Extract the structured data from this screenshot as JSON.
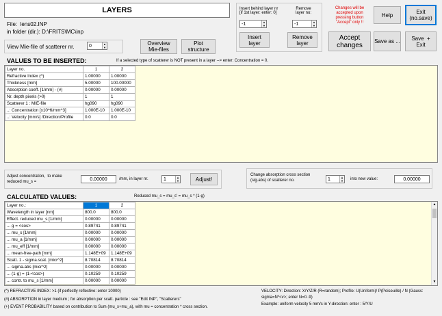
{
  "title": "LAYERS",
  "file_label": "File:",
  "file_name": "lens02.INP",
  "folder_label": "in folder (dir.):",
  "folder_path": "D:\\FRITS\\MC\\inp",
  "view_mie_label": "View Mie-file of scatterer nr.",
  "view_mie_value": "0",
  "overview_btn": "Overview\nMie-files",
  "plot_btn": "Plot\nstructure",
  "insert_behind_label": "Insert behind layer nr\n[if 1st layer: enter: 0]",
  "insert_value": "-1",
  "remove_label": "Remove\nlayer no:",
  "remove_value": "-1",
  "insert_btn": "Insert\nlayer",
  "remove_btn": "Remove\nlayer",
  "changes_note": "Changes will be\naccepted upon\npressing button\n\"Accept\" only !!",
  "accept_btn": "Accept\nchanges",
  "help_btn": "Help",
  "exit_nosave_btn": "Exit\n(no.save)",
  "save_as_btn": "Save as ...",
  "save_exit_btn": "Save  +\nExit",
  "values_header": "VALUES TO BE INSERTED:",
  "values_hint": "If a selected type of scatterer is NOT present in a layer -->  enter: Concentration = 0.",
  "values_table": {
    "rows": [
      [
        "Layer no.",
        "1",
        "2"
      ],
      [
        "Refractive Index (^)",
        "1.00000",
        "1.00000"
      ],
      [
        "Thickness [mm]",
        "5.00000",
        "100.00000"
      ],
      [
        "Absorption coeff. [1/mm] - (#)",
        "0.00000",
        "0.00000"
      ],
      [
        "Nr. depth pixels (>0)",
        "1",
        "1"
      ],
      [
        "Scatterer 1 : MIE-file",
        "hg090",
        "hg090"
      ],
      [
        "..: Concentration [x10^6/mm^3]",
        "1.000E-10",
        "1.000E-10"
      ],
      [
        "..: Velocity [mm/s] /Direction/Profile",
        "0.0",
        "0.0"
      ]
    ]
  },
  "adjust_label": "Adjust concentration,  to make\nreduced mu_s =",
  "adjust_value": "0.00000",
  "adjust_mid_label": "/mm, in layer nr.",
  "adjust_layer": "1",
  "adjust_btn": "Adjust!",
  "abs_change_label": "Change absorption cross section\n(sig.abs) of scatterer no.",
  "abs_scatterer": "1",
  "abs_new_label": "into new value:",
  "abs_new_value": "0.00000",
  "calc_header": "CALCULATED VALUES:",
  "calc_hint": "Reduced mu_s = mu_s' = mu_s * (1-g)",
  "calc_table": {
    "rows": [
      [
        "Layer no.:",
        "1",
        "2"
      ],
      [
        "Wavelength in layer [nm]",
        "800.0",
        "800.0"
      ],
      [
        "Effect. reduced mu_s [1/mm]",
        "0.00000",
        "0.00000"
      ],
      [
        "... g = <cos>",
        "0.89741",
        "0.89741"
      ],
      [
        "... mu_s  [1/mm]",
        "0.00000",
        "0.00000"
      ],
      [
        "... mu_a  [1/mm]",
        "0.00000",
        "0.00000"
      ],
      [
        "... mu_eff [1/mm]",
        "0.00000",
        "0.00000"
      ],
      [
        "... mean-free-path   [mm]",
        "1.148E+09",
        "1.148E+09"
      ],
      [
        "Scatt. 1 - sigma.scat. [micr^2]",
        "8.70814",
        "8.70814"
      ],
      [
        "... sigma.abs [micr^2]",
        "0.00000",
        "0.00000"
      ],
      [
        "... (1-g) = (1-<cos>)",
        "0.10259",
        "0.10259"
      ],
      [
        "... contr. to mu_s [1/mm]",
        "0.00000",
        "0.00000"
      ]
    ]
  },
  "note1": "(^) REFRACTIVE INDEX: >1 (if perfectly reflective: enter 10000)",
  "note2": "(#) ABSORPTION in layer medium ; for absorption per scatt. particle : see \"Edit INP\", \"Scatterers\"",
  "note3": "(+) EVENT PROBABILITY based on contribution to Sum (mu_s+mu_a), with mu = concentration * cross section.",
  "velocity_note1": "VELOCITY: Direction: X/Y/Z/R (R=random);  Profile: U(Uniform)/ P(Poiseuille) / N (Gauss:",
  "velocity_note2": "sigma=N*<v>; enter N=0..9)",
  "velocity_note3": "Example: uniform velocity 5 mm/s in Y-direction: enter : 5/Y/U"
}
